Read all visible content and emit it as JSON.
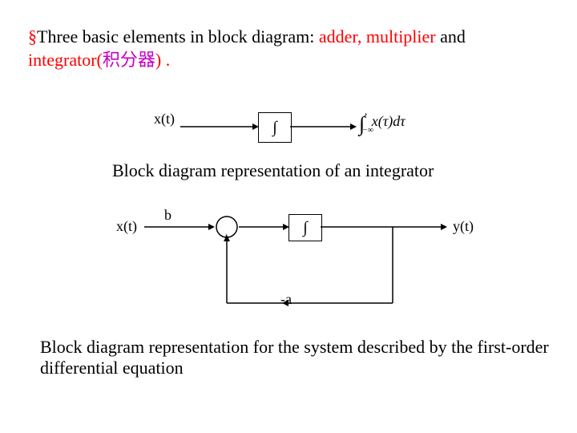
{
  "title": {
    "bullet": "§",
    "text_before_adder": "Three basic elements in block diagram: ",
    "adder": "adder,",
    "multiplier_prefix": " ",
    "multiplier": "multiplier",
    "text_after_multiplier": " and",
    "integrator": "integrator",
    "paren_open": "(",
    "chinese": "积分器",
    "paren_close_period": ") ."
  },
  "diagram1": {
    "input_label": "x(t)",
    "block_symbol": "∫",
    "output_expr_int": "∫",
    "output_expr_upper": "t",
    "output_expr_lower": "−∞",
    "output_expr_body": "x(τ)dτ"
  },
  "caption1": "Block diagram representation of an integrator",
  "diagram2": {
    "input_label": "x(t)",
    "gain_b": "b",
    "adder_plus": "+",
    "block_symbol": "∫",
    "output_label": "y(t)",
    "feedback_gain": "-a"
  },
  "caption2": "Block diagram representation for the system described  by the first-order differential equation"
}
